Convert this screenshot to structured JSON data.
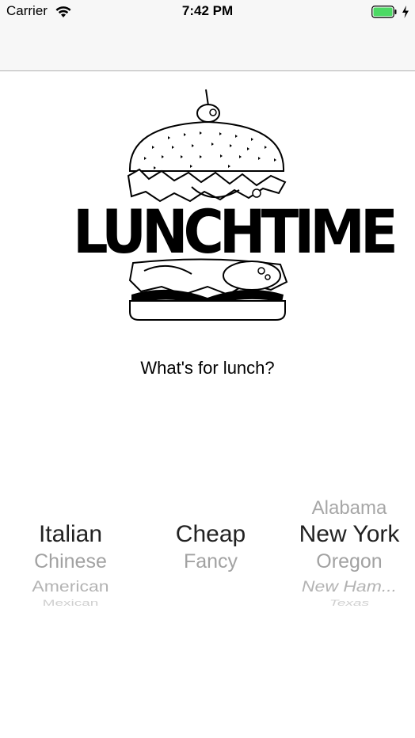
{
  "status_bar": {
    "carrier": "Carrier",
    "time": "7:42 PM",
    "battery_color": "#4cd964"
  },
  "logo": {
    "text": "LUNCHTIME"
  },
  "prompt": "What's for lunch?",
  "pickers": {
    "cuisine": {
      "selected": "Italian",
      "below": [
        "Chinese",
        "American",
        "Mexican"
      ]
    },
    "price": {
      "selected": "Cheap",
      "below": [
        "Fancy"
      ]
    },
    "state": {
      "above": "Alabama",
      "selected": "New York",
      "below": [
        "Oregon",
        "New Ham...",
        "Texas"
      ]
    }
  }
}
